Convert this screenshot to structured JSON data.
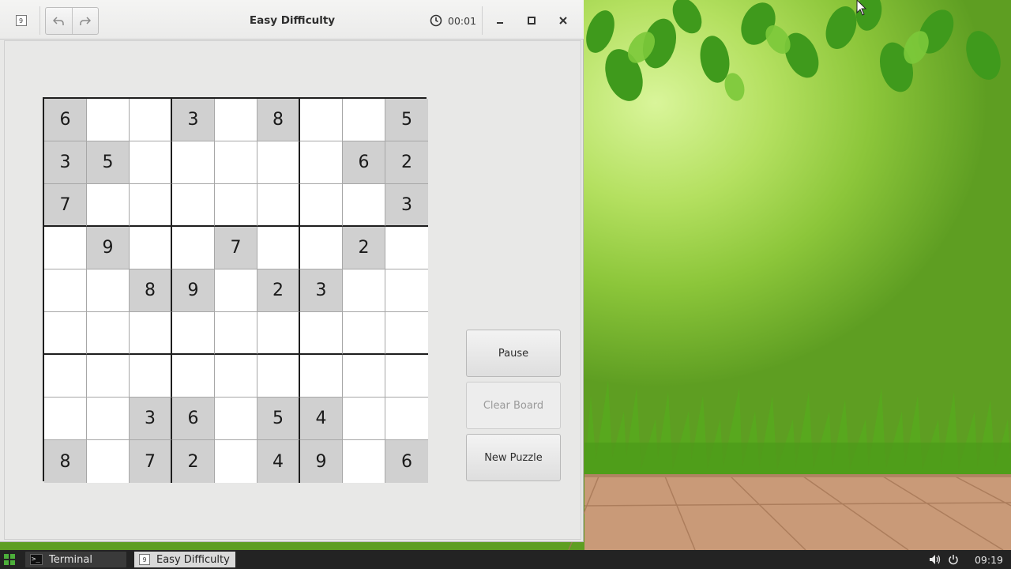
{
  "window": {
    "title": "Easy Difficulty",
    "timer": "00:01"
  },
  "board": [
    [
      6,
      null,
      null,
      3,
      null,
      8,
      null,
      null,
      5
    ],
    [
      3,
      5,
      null,
      null,
      null,
      null,
      null,
      6,
      2
    ],
    [
      7,
      null,
      null,
      null,
      null,
      null,
      null,
      null,
      3
    ],
    [
      null,
      9,
      null,
      null,
      7,
      null,
      null,
      2,
      null
    ],
    [
      null,
      null,
      8,
      9,
      null,
      2,
      3,
      null,
      null
    ],
    [
      null,
      null,
      null,
      null,
      null,
      null,
      null,
      null,
      null
    ],
    [
      null,
      null,
      null,
      null,
      null,
      null,
      null,
      null,
      null
    ],
    [
      null,
      null,
      3,
      6,
      null,
      5,
      4,
      null,
      null
    ],
    [
      8,
      null,
      7,
      2,
      null,
      4,
      9,
      null,
      6
    ]
  ],
  "buttons": {
    "pause": "Pause",
    "clear_board": "Clear Board",
    "new_puzzle": "New Puzzle"
  },
  "taskbar": {
    "tasks": [
      {
        "label": "Terminal",
        "icon": "terminal-icon"
      },
      {
        "label": "Easy Difficulty",
        "icon": "sudoku-app-icon"
      }
    ],
    "clock": "09:19"
  },
  "colors": {
    "given_cell": "#d0d0d0",
    "empty_cell": "#ffffff",
    "taskbar": "#232323",
    "start_button": "#4caf3a"
  }
}
